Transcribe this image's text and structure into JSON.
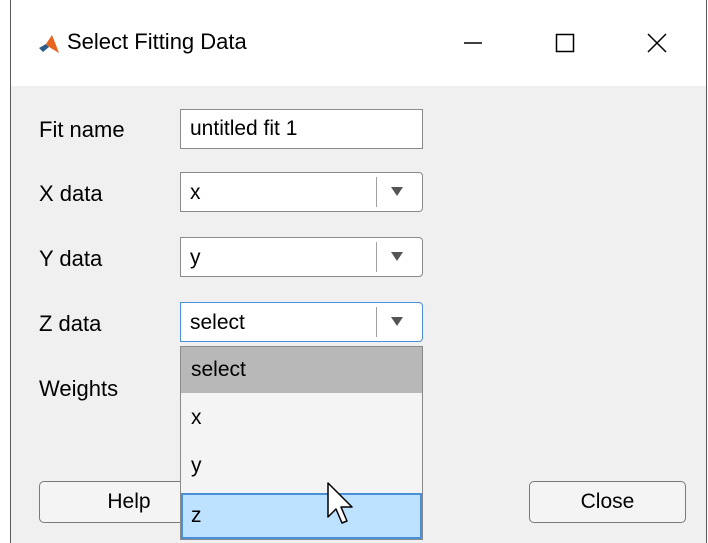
{
  "window": {
    "title": "Select Fitting Data",
    "icon": "matlab-logo-icon",
    "controls": [
      "minimize-icon",
      "maximize-icon",
      "close-icon"
    ]
  },
  "form": {
    "fit_name": {
      "label": "Fit name",
      "value": "untitled fit 1"
    },
    "x_data": {
      "label": "X data",
      "value": "x"
    },
    "y_data": {
      "label": "Y data",
      "value": "y"
    },
    "z_data": {
      "label": "Z data",
      "value": "select",
      "open": true
    },
    "weights": {
      "label": "Weights"
    }
  },
  "dropdown": {
    "options": [
      "select",
      "x",
      "y",
      "z"
    ],
    "selected_index": 0,
    "hover_index": 3
  },
  "buttons": {
    "help": "Help",
    "close": "Close"
  },
  "colors": {
    "selected_bg": "#b8b8b8",
    "hover_bg": "#bde2ff",
    "focus_border": "#4a8fd8"
  }
}
